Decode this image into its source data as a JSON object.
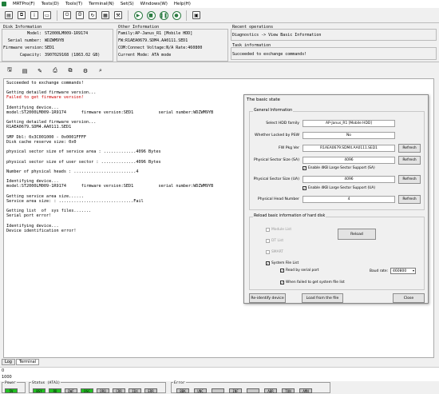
{
  "menu": [
    "MRTPro(F)",
    "Tests(D)",
    "Tools(T)",
    "Terminal(N)",
    "Set(S)",
    "Windows(W)",
    "Help(H)"
  ],
  "disk_info": {
    "title": "Disk Information",
    "model_label": "Model:",
    "model": "ST2000LM009-1R9174",
    "serial_label": "Serial number:",
    "serial": "WDZWM9YB",
    "firmware_label": "Firmware version:",
    "firmware": "SED1",
    "capacity_label": "Capacity:",
    "capacity": "3907029168 (1863.02 GB)"
  },
  "other_info": {
    "title": "Other Information",
    "family": "Family:AP-Janus_R1 [Mobile HDD]",
    "fw": "FW:R1AEA0679.SDM4.AA0111.SED1",
    "com": "COM:Connect Voltage:N/A Rate:460800",
    "mode": "Current Mode: ATA mode"
  },
  "recent_ops": {
    "title": "Recent operations",
    "value": "Diagnostics -> View Basic Information"
  },
  "task_info": {
    "title": "Task information",
    "value": "Succeeded to exchange commands!"
  },
  "log": [
    "Succeeded to exchange commands!",
    "",
    "Getting detailed firmware version...",
    "Failed to get firmware version!",
    "",
    "Identifying device...",
    "model:ST2000LM009-1R9174      firmware version:SED1          serial number:WDZWM9YB",
    "",
    "Getting detailed firmware version...",
    "R1AEA0679.SDM4.AA0111.SED1",
    "",
    "SMP Dbl: 0x3C001000 - 0x0001FFFF",
    "Disk cache reserve size: 0x0",
    "",
    "physical sector size of service area : .............4096 Bytes",
    "",
    "physical sector size of user sector : ..............4096 Bytes",
    "",
    "Number of physical heads : .........................4",
    "",
    "Identifying device...",
    "model:ST2000LM009-1R9174      firmware version:SED1          serial number:WDZWM9YB",
    "",
    "Getting service area size......",
    "Service area size: : ..............................Fail",
    "",
    "Getting list  of  sys files.......",
    "Serial port error!",
    "",
    "Identifying device...",
    "Device identification error!",
    "",
    "",
    "",
    ""
  ],
  "dialog": {
    "title": "The basic state",
    "refresh_label": "Refresh",
    "general": {
      "legend": "General Information",
      "fields": [
        {
          "label": "Select HDD family",
          "value": "AP-Janus_R1 [Mobile HDD]"
        },
        {
          "label": "Whether Locked by PSW",
          "value": "No"
        },
        {
          "label": "FW Pkg Ver",
          "value": "R1AEA0679.SDM4.AA0111.SED1"
        },
        {
          "label": "Physical Sector Size (SA)",
          "value": "4096"
        },
        {
          "label": "Physical Sector Size (UA)",
          "value": "4096"
        },
        {
          "label": "Physical Head Number",
          "value": "4"
        }
      ],
      "enable_sa": "Enable 4KB Large Sector Support (SA)",
      "enable_ua": "Enable 4KB Large Sector Support (UA)"
    },
    "reload": {
      "legend": "Reload basic information of hard disk",
      "module_list": "Module List",
      "dt_list": "DT List",
      "smart": "SMART",
      "reload_btn": "Reload",
      "system_file_list": "System File List",
      "read_serial": "Read by serial port",
      "baud_label": "Baud rate:",
      "baud_value": "460800",
      "when_failed": "When failed to get system file list"
    },
    "buttons": {
      "reidentify": "Re-identify device",
      "load": "Load from the file",
      "close": "Close"
    }
  },
  "tabs": [
    "Log",
    "Terminal"
  ],
  "ruler": {
    "start": "0",
    "end": "1000"
  },
  "status": {
    "power_label": "Power",
    "power_led": "5V",
    "ata_label": "Status (ATA1)",
    "ata_leds": [
      "BSY",
      "RD",
      "DWF",
      "DSC",
      "DRQ",
      "CRR",
      "IDX",
      "ERR"
    ],
    "error_label": "Error",
    "error_leds": [
      "BBK",
      "UNC",
      "",
      "INF",
      "",
      "ABR",
      "TON",
      "AMN"
    ]
  },
  "colors": {
    "error_text": "#d00000",
    "led_on": "#22c022",
    "led_off": "#c8c8c8"
  }
}
